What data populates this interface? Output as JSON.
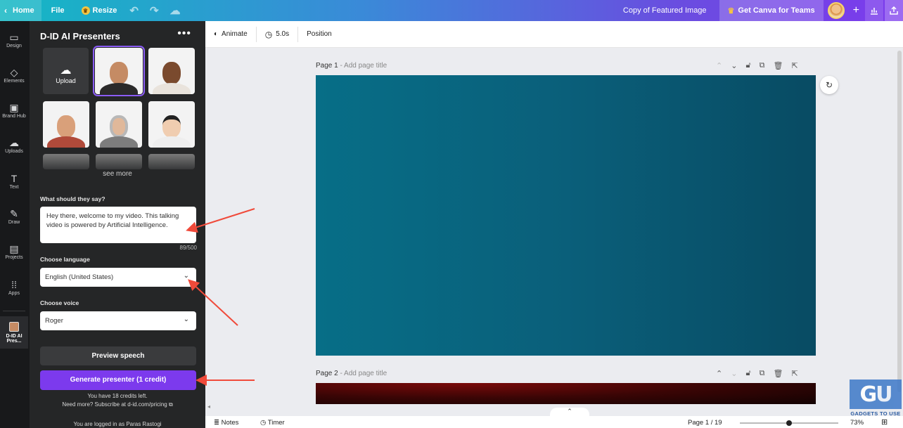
{
  "topbar": {
    "home_label": "Home",
    "file_label": "File",
    "resize_label": "Resize",
    "title": "Copy of Featured Image",
    "teams_label": "Get Canva for Teams",
    "plus_label": "+"
  },
  "rail": {
    "items": [
      {
        "label": "Design",
        "icon": "▭"
      },
      {
        "label": "Elements",
        "icon": "◇"
      },
      {
        "label": "Brand Hub",
        "icon": "▣"
      },
      {
        "label": "Uploads",
        "icon": "☁"
      },
      {
        "label": "Text",
        "icon": "T"
      },
      {
        "label": "Draw",
        "icon": "✎"
      },
      {
        "label": "Projects",
        "icon": "▤"
      },
      {
        "label": "Apps",
        "icon": "⁞⁞"
      },
      {
        "label": "D-ID AI Pres...",
        "icon": ""
      }
    ]
  },
  "panel": {
    "title": "D-ID AI Presenters",
    "menu_label": "•••",
    "upload_label": "Upload",
    "see_more_label": "see more",
    "script_label": "What should they say?",
    "script_text": "Hey there, welcome to my video. This talking video is powered by Artificial Intelligence.",
    "counter": "89/500",
    "language_label": "Choose language",
    "language_value": "English (United States)",
    "voice_label": "Choose voice",
    "voice_value": "Roger",
    "preview_label": "Preview speech",
    "generate_label": "Generate presenter (1 credit)",
    "credits_text": "You have 18 credits left.",
    "more_text": "Need more? Subscribe at d-id.com/pricing",
    "login_text": "You are logged in as Paras Rastogi"
  },
  "toolbar": {
    "animate_label": "Animate",
    "duration_label": "5.0s",
    "position_label": "Position"
  },
  "canvas": {
    "page1_label": "Page 1",
    "page2_label": "Page 2",
    "add_title_label": " - Add page title"
  },
  "bottombar": {
    "notes_label": "Notes",
    "timer_label": "Timer",
    "page_indicator": "Page 1 / 19",
    "zoom_label": "73%",
    "zoom_fraction": 0.47
  },
  "watermark": {
    "logo": "GU",
    "text": "GADGETS TO USE"
  },
  "colors": {
    "accent": "#7c3aed",
    "page1_bg": "#0a5f7a",
    "annotation_arrow": "#f04a3a"
  }
}
